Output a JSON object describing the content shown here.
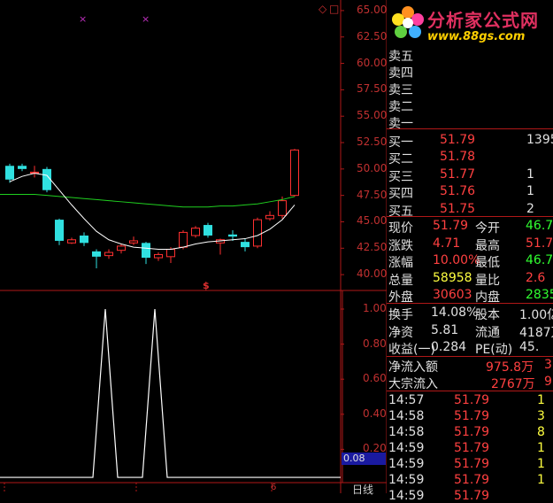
{
  "chart_data": {
    "type": "candlestick",
    "price_axis": {
      "ticks": [
        "65.00",
        "62.50",
        "60.00",
        "57.50",
        "55.00",
        "52.50",
        "50.00",
        "47.50",
        "45.00",
        "42.50",
        "40.00"
      ],
      "range": [
        38.5,
        66
      ]
    },
    "indicator_axis": {
      "ticks": [
        "1.00",
        "0.80",
        "0.60",
        "0.40",
        "0.20"
      ],
      "range": [
        0,
        1.0
      ]
    },
    "indicator_value_label": "0.08",
    "candles": [
      {
        "o": 49.0,
        "c": 50.3,
        "h": 50.5,
        "l": 48.7,
        "up": false
      },
      {
        "o": 50.3,
        "c": 50.0,
        "h": 50.5,
        "l": 49.8,
        "up": false
      },
      {
        "o": 49.7,
        "c": 49.7,
        "h": 50.3,
        "l": 49.2,
        "up": true
      },
      {
        "o": 50.0,
        "c": 48.0,
        "h": 50.2,
        "l": 47.8,
        "up": false
      },
      {
        "o": 45.2,
        "c": 43.2,
        "h": 45.3,
        "l": 42.8,
        "up": false
      },
      {
        "o": 43.0,
        "c": 43.3,
        "h": 43.5,
        "l": 42.9,
        "up": true
      },
      {
        "o": 43.7,
        "c": 43.0,
        "h": 44.0,
        "l": 42.7,
        "up": false
      },
      {
        "o": 42.2,
        "c": 41.7,
        "h": 42.4,
        "l": 40.6,
        "up": false
      },
      {
        "o": 41.8,
        "c": 42.1,
        "h": 42.4,
        "l": 41.5,
        "up": true
      },
      {
        "o": 42.3,
        "c": 42.7,
        "h": 42.9,
        "l": 42.0,
        "up": true
      },
      {
        "o": 43.0,
        "c": 43.2,
        "h": 43.6,
        "l": 42.8,
        "up": true
      },
      {
        "o": 43.0,
        "c": 41.6,
        "h": 43.1,
        "l": 41.0,
        "up": false
      },
      {
        "o": 41.6,
        "c": 41.9,
        "h": 42.1,
        "l": 41.3,
        "up": true
      },
      {
        "o": 41.7,
        "c": 42.4,
        "h": 42.6,
        "l": 41.1,
        "up": true
      },
      {
        "o": 42.6,
        "c": 44.0,
        "h": 44.2,
        "l": 42.4,
        "up": true
      },
      {
        "o": 43.7,
        "c": 44.4,
        "h": 44.6,
        "l": 43.5,
        "up": true
      },
      {
        "o": 44.7,
        "c": 43.7,
        "h": 44.9,
        "l": 43.5,
        "up": false
      },
      {
        "o": 43.0,
        "c": 43.3,
        "h": 43.4,
        "l": 41.9,
        "up": true
      },
      {
        "o": 43.8,
        "c": 43.6,
        "h": 44.2,
        "l": 43.2,
        "up": false
      },
      {
        "o": 43.1,
        "c": 42.6,
        "h": 43.4,
        "l": 42.2,
        "up": false
      },
      {
        "o": 42.7,
        "c": 45.2,
        "h": 45.4,
        "l": 42.5,
        "up": true
      },
      {
        "o": 45.3,
        "c": 45.6,
        "h": 46.0,
        "l": 45.1,
        "up": true
      },
      {
        "o": 45.6,
        "c": 47.0,
        "h": 47.4,
        "l": 45.3,
        "up": true
      },
      {
        "o": 47.5,
        "c": 51.8,
        "h": 51.9,
        "l": 47.4,
        "up": true
      }
    ],
    "ma_short": [
      48.8,
      49.3,
      49.6,
      49.4,
      48.0,
      46.6,
      45.3,
      44.1,
      43.3,
      42.9,
      42.6,
      42.5,
      42.4,
      42.4,
      42.6,
      42.9,
      43.1,
      43.2,
      43.3,
      43.4,
      43.7,
      44.3,
      45.2,
      46.6
    ],
    "ma_long": [
      47.6,
      47.6,
      47.6,
      47.5,
      47.4,
      47.3,
      47.2,
      47.1,
      47.0,
      46.9,
      46.8,
      46.7,
      46.6,
      46.5,
      46.4,
      46.4,
      46.4,
      46.5,
      46.5,
      46.6,
      46.7,
      46.9,
      47.1,
      47.4
    ],
    "indicator_series": [
      0.04,
      0.04,
      0.04,
      0.04,
      0.04,
      0.04,
      0.04,
      0.04,
      1.0,
      0.04,
      0.04,
      0.04,
      1.0,
      0.04,
      0.04,
      0.04,
      0.04,
      0.04,
      0.04,
      0.04,
      0.04,
      0.04,
      0.04,
      0.04
    ],
    "colors": {
      "up": "#ff3030",
      "down": "#30e0e0",
      "ma_short": "#ffffff",
      "ma_long": "#20d020",
      "axis": "#c02020",
      "indicator": "#ffffff"
    }
  },
  "chart": {
    "marker_top_1": "×",
    "marker_top_2": "×",
    "diamond_icon": "◇",
    "box_icon": "□",
    "dollar_marker": "$",
    "bottom_label": "日线",
    "bottom_tick": "6"
  },
  "logo": {
    "title": "分析家公式网",
    "url": "www.88gs.com"
  },
  "order_book": {
    "sell": [
      {
        "label": "卖五"
      },
      {
        "label": "卖四"
      },
      {
        "label": "卖三"
      },
      {
        "label": "卖二"
      },
      {
        "label": "卖一"
      }
    ],
    "buy": [
      {
        "label": "买一",
        "price": "51.79",
        "vol": "1395"
      },
      {
        "label": "买二",
        "price": "51.78",
        "vol": ""
      },
      {
        "label": "买三",
        "price": "51.77",
        "vol": "1"
      },
      {
        "label": "买四",
        "price": "51.76",
        "vol": "1"
      },
      {
        "label": "买五",
        "price": "51.75",
        "vol": "2"
      }
    ]
  },
  "quote": {
    "now_label": "现价",
    "now": "51.79",
    "open_label": "今开",
    "open": "46.7",
    "chg_label": "涨跌",
    "chg": "4.71",
    "high_label": "最高",
    "high": "51.7",
    "pct_label": "涨幅",
    "pct": "10.00%",
    "low_label": "最低",
    "low": "46.7",
    "vol_label": "总量",
    "vol": "58958",
    "ratio_label": "量比",
    "ratio": "2.6",
    "outer_label": "外盘",
    "outer": "30603",
    "inner_label": "内盘",
    "inner": "2835"
  },
  "fundamentals": {
    "turnover_label": "换手",
    "turnover": "14.08%",
    "equity_label": "股本",
    "equity": "1.00亿",
    "nav_label": "净资",
    "nav": "5.81",
    "float_label": "流通",
    "float": "4187万",
    "eps_label": "收益(一)",
    "eps": "0.284",
    "pe_label": "PE(动)",
    "pe": "45."
  },
  "flow": {
    "net_label": "净流入额",
    "net": "975.8万",
    "net_extra": "3",
    "block_label": "大宗流入",
    "block": "2767万",
    "block_extra": "9"
  },
  "ticks": [
    {
      "time": "14:57",
      "price": "51.79",
      "vol": "1"
    },
    {
      "time": "14:58",
      "price": "51.79",
      "vol": "3"
    },
    {
      "time": "14:58",
      "price": "51.79",
      "vol": "8"
    },
    {
      "time": "14:59",
      "price": "51.79",
      "vol": "1"
    },
    {
      "time": "14:59",
      "price": "51.79",
      "vol": "1"
    },
    {
      "time": "14:59",
      "price": "51.79",
      "vol": "1"
    },
    {
      "time": "14:59",
      "price": "51.79",
      "vol": ""
    }
  ]
}
